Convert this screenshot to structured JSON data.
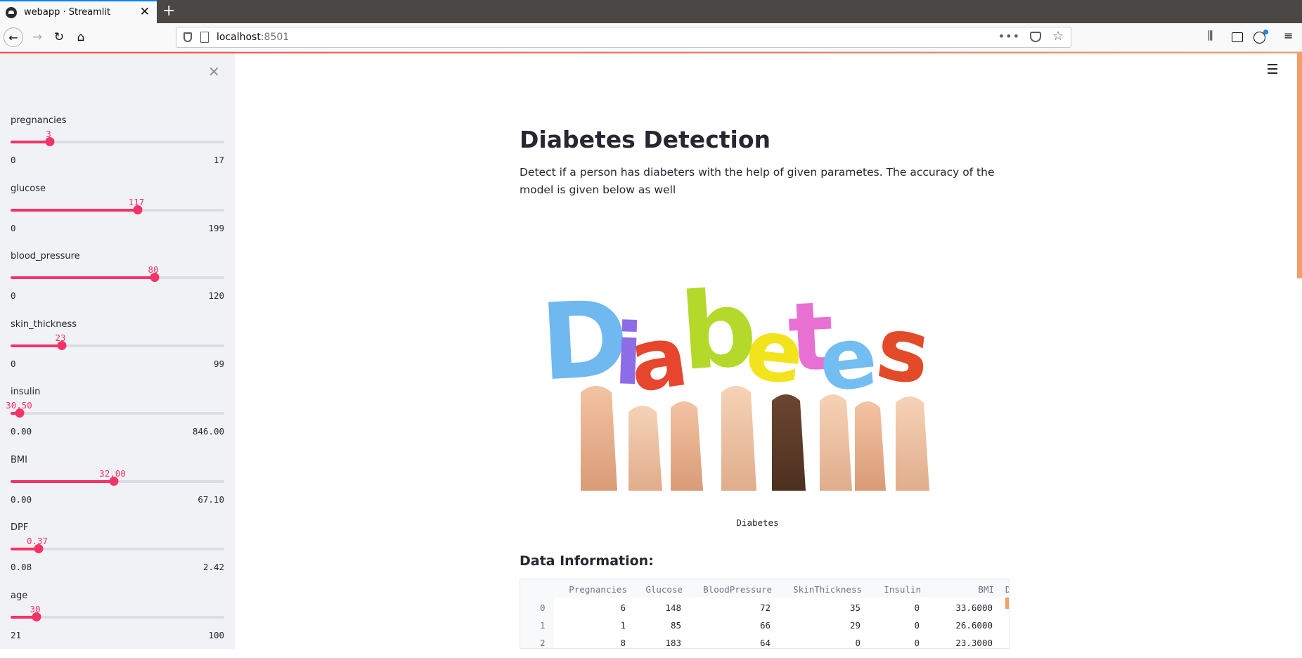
{
  "browser": {
    "tab_title": "webapp · Streamlit",
    "url_host": "localhost",
    "url_port": ":8501"
  },
  "sidebar": {
    "sliders": [
      {
        "label": "pregnancies",
        "value": "3",
        "min": "0",
        "max": "17",
        "fraction": 0.176
      },
      {
        "label": "glucose",
        "value": "117",
        "min": "0",
        "max": "199",
        "fraction": 0.588
      },
      {
        "label": "blood_pressure",
        "value": "80",
        "min": "0",
        "max": "120",
        "fraction": 0.667
      },
      {
        "label": "skin_thickness",
        "value": "23",
        "min": "0",
        "max": "99",
        "fraction": 0.232
      },
      {
        "label": "insulin",
        "value": "30.50",
        "min": "0.00",
        "max": "846.00",
        "fraction": 0.036
      },
      {
        "label": "BMI",
        "value": "32.00",
        "min": "0.00",
        "max": "67.10",
        "fraction": 0.477
      },
      {
        "label": "DPF",
        "value": "0.37",
        "min": "0.08",
        "max": "2.42",
        "fraction": 0.124
      },
      {
        "label": "age",
        "value": "30",
        "min": "21",
        "max": "100",
        "fraction": 0.114
      }
    ]
  },
  "main": {
    "title": "Diabetes Detection",
    "description": "Detect if a person has diabeters with the help of given parametes. The accuracy of the model is given below as well",
    "image_caption": "Diabetes",
    "image_word": "Diabetes",
    "section_heading": "Data Information:",
    "table": {
      "columns": [
        "Pregnancies",
        "Glucose",
        "BloodPressure",
        "SkinThickness",
        "Insulin",
        "BMI",
        "Diab"
      ],
      "rows": [
        {
          "index": "0",
          "cells": [
            "6",
            "148",
            "72",
            "35",
            "0",
            "33.6000"
          ]
        },
        {
          "index": "1",
          "cells": [
            "1",
            "85",
            "66",
            "29",
            "0",
            "26.6000"
          ]
        },
        {
          "index": "2",
          "cells": [
            "8",
            "183",
            "64",
            "0",
            "0",
            "23.3000"
          ]
        }
      ]
    }
  },
  "colors": {
    "accent": "#f63366",
    "sidebar_bg": "#f0f2f6",
    "track": "#dcdde4",
    "letters": [
      "#6fb8f0",
      "#8d6ce8",
      "#e8452e",
      "#b4d92a",
      "#f2e41c",
      "#e770d2",
      "#72bdf1",
      "#e24a2a"
    ]
  },
  "icons": {
    "nav": [
      "back-arrow-icon",
      "forward-arrow-icon",
      "reload-icon",
      "home-icon"
    ],
    "sidebar_close": "close-icon",
    "menu": "hamburger-menu-icon"
  }
}
